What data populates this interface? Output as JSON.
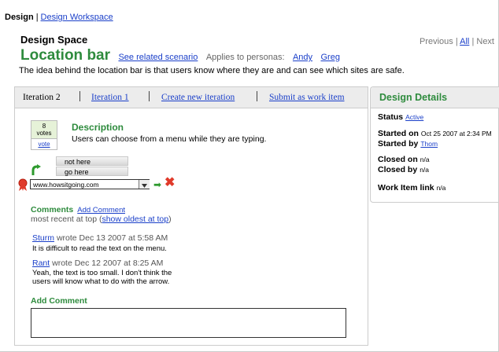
{
  "breadcrumb": {
    "root": "Design",
    "separator": "|",
    "workspace": "Design Workspace"
  },
  "space_title": "Design Space",
  "pager": {
    "previous": "Previous",
    "sep1": "|",
    "all": "All",
    "sep2": "|",
    "next": "Next"
  },
  "item": {
    "title": "Location bar",
    "related_link": "See related scenario",
    "personas_label": "Applies to personas:",
    "personas": [
      "Andy",
      "Greg"
    ],
    "idea": "The idea behind the location bar is that users know where they are and can see which sites are safe."
  },
  "tabs": {
    "current": "Iteration 2",
    "iteration1": "Iteration 1",
    "create": "Create new iteration",
    "submit": "Submit as work item"
  },
  "vote": {
    "count": "8",
    "unit": "votes",
    "action": "vote"
  },
  "description": {
    "heading": "Description",
    "text": "Users can choose from a menu while they are typing."
  },
  "mockup": {
    "suggestions": [
      "not here",
      "go here"
    ],
    "url": "www.howsitgoing.com",
    "go_icon": "go-arrow-icon",
    "cancel_icon": "cancel-x-icon"
  },
  "comments": {
    "heading": "Comments",
    "add_link": "Add Comment",
    "order_prefix": "most recent at top (",
    "order_link": "show oldest at top",
    "order_suffix": ")",
    "items": [
      {
        "author": "Sturm",
        "meta": "wrote Dec 13 2007 at 5:58 AM",
        "text": "It is difficult to read the text on the menu."
      },
      {
        "author": "Rant",
        "meta": "wrote Dec 12 2007 at 8:25 AM",
        "text_line1": "Yeah, the text is too small. I don't think the",
        "text_line2": "users will know what to do with the arrow."
      }
    ],
    "add_heading": "Add Comment"
  },
  "details": {
    "heading": "Design Details",
    "status_label": "Status",
    "status_value": "Active",
    "started_on_label": "Started on",
    "started_on_value": "Oct 25 2007 at 2:34 PM",
    "started_by_label": "Started by",
    "started_by_value": "Thom",
    "closed_on_label": "Closed on",
    "closed_on_value": "n/a",
    "closed_by_label": "Closed by",
    "closed_by_value": "n/a",
    "work_item_label": "Work Item link",
    "work_item_value": "n/a"
  },
  "colors": {
    "accent_green": "#2e8b3d",
    "link_blue": "#1a3fc9",
    "cancel_red": "#e03a2a"
  }
}
